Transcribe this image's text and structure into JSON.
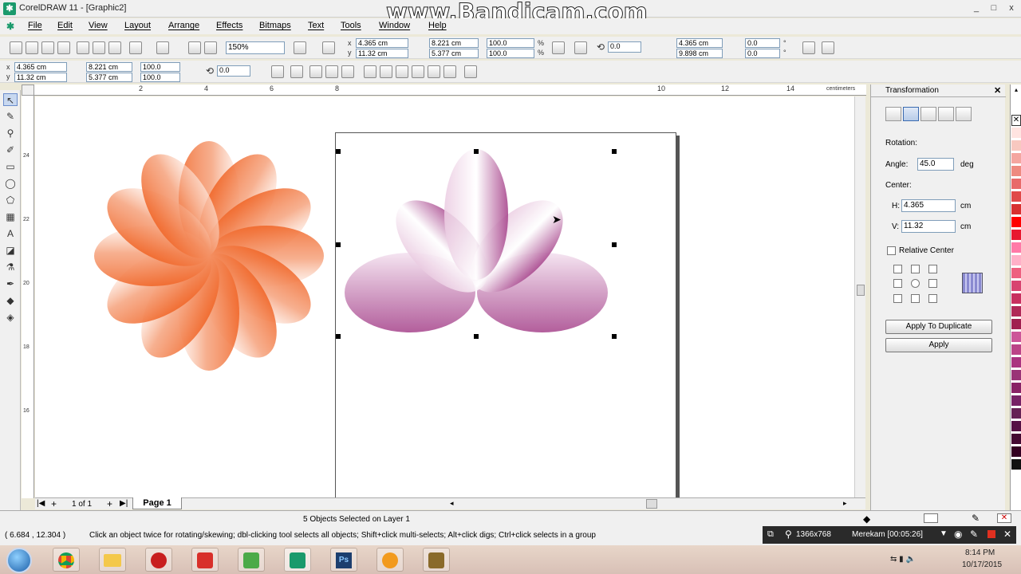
{
  "window": {
    "title": "CorelDRAW 11 - [Graphic2]",
    "watermark": "www.Bandicam.com",
    "controls": [
      "_",
      "□",
      "x"
    ]
  },
  "menu": [
    "File",
    "Edit",
    "View",
    "Layout",
    "Arrange",
    "Effects",
    "Bitmaps",
    "Text",
    "Tools",
    "Window",
    "Help"
  ],
  "standard_toolbar": {
    "zoom": "150%",
    "x": "4.365 cm",
    "y": "11.32 cm",
    "width": "8.221 cm",
    "height": "5.377 cm",
    "scale_x": "100.0",
    "scale_y": "100.0",
    "scale_unit": "%",
    "rotation": "0.0",
    "center_x": "4.365 cm",
    "center_y": "9.898 cm",
    "skew_x": "0.0",
    "skew_y": "0.0",
    "skew_unit": "°"
  },
  "property_bar": {
    "x": "4.365 cm",
    "y": "11.32 cm",
    "width": "8.221 cm",
    "height": "5.377 cm",
    "scale_x": "100.0",
    "scale_y": "100.0",
    "rotation": "0.0"
  },
  "ruler": {
    "unit": "centimeters",
    "top_ticks": [
      "2",
      "4",
      "6",
      "8",
      "10",
      "12",
      "14"
    ],
    "left_ticks": [
      "24",
      "22",
      "20",
      "18",
      "16"
    ],
    "left_unit": "centimeters"
  },
  "page_nav": {
    "counter": "1 of 1",
    "tab": "Page 1"
  },
  "docker": {
    "title": "Transformation",
    "section_rotation": "Rotation:",
    "angle_label": "Angle:",
    "angle_value": "45.0",
    "angle_unit": "deg",
    "section_center": "Center:",
    "h_label": "H:",
    "h_value": "4.365",
    "h_unit": "cm",
    "v_label": "V:",
    "v_value": "11.32",
    "v_unit": "cm",
    "relative_center": "Relative Center",
    "apply_duplicate": "Apply To Duplicate",
    "apply": "Apply"
  },
  "status": {
    "selection": "5 Objects Selected on Layer 1",
    "coords": "( 6.684 , 12.304 )",
    "hint": "Click an object twice for rotating/skewing; dbl-clicking tool selects all objects; Shift+click multi-selects; Alt+click digs; Ctrl+click selects in a group"
  },
  "bandicam": {
    "resolution": "1366x768",
    "recording": "Merekam [00:05:26]"
  },
  "taskbar": {
    "time": "8:14 PM",
    "date": "10/17/2015",
    "apps": [
      "start-orb",
      "chrome",
      "explorer",
      "recorder",
      "sketchup",
      "corel-x",
      "coreldraw",
      "photoshop",
      "media-player",
      "paint"
    ]
  },
  "colors": {
    "flower_orange": "#f06425",
    "flower_purple": "#9c2e7e",
    "palette": [
      "#ffe4e1",
      "#f8c8c0",
      "#f4a6a0",
      "#ee8a80",
      "#e86a6a",
      "#e04848",
      "#d83030",
      "#ff0000",
      "#e81830",
      "#ff7aa8",
      "#ffb0c8",
      "#ee6080",
      "#d84470",
      "#c83060",
      "#b02858",
      "#a02050",
      "#cc5599",
      "#bb4488",
      "#aa3380",
      "#993377",
      "#882266",
      "#772266",
      "#662255",
      "#551144",
      "#440a33",
      "#330022",
      "#111111"
    ]
  }
}
